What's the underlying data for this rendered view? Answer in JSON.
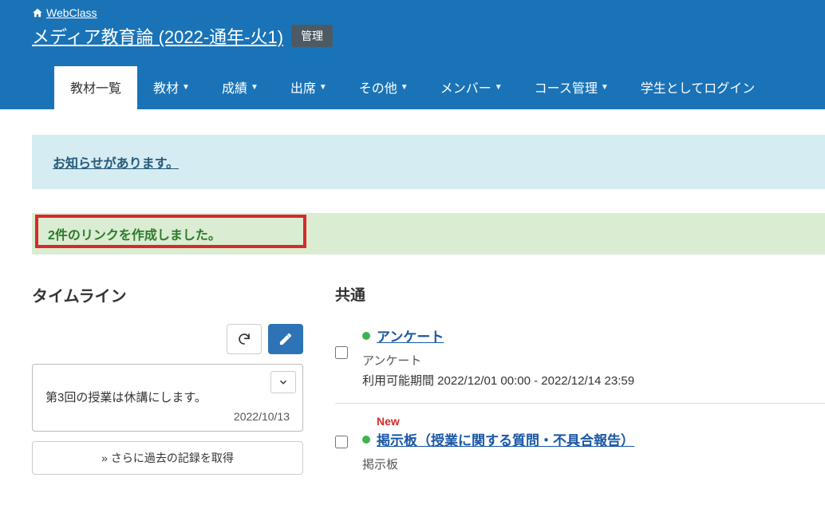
{
  "brand": "WebClass",
  "course": {
    "title": "メディア教育論 (2022-通年-火1)",
    "admin_label": "管理"
  },
  "nav": {
    "active": "教材一覧",
    "items": [
      {
        "label": "教材一覧",
        "dropdown": false
      },
      {
        "label": "教材",
        "dropdown": true
      },
      {
        "label": "成績",
        "dropdown": true
      },
      {
        "label": "出席",
        "dropdown": true
      },
      {
        "label": "その他",
        "dropdown": true
      },
      {
        "label": "メンバー",
        "dropdown": true
      },
      {
        "label": "コース管理",
        "dropdown": true
      },
      {
        "label": "学生としてログイン",
        "dropdown": false
      }
    ]
  },
  "notice": {
    "text": "お知らせがあります。"
  },
  "success": {
    "text": "2件のリンクを作成しました。"
  },
  "timeline": {
    "heading": "タイムライン",
    "item": {
      "message": "第3回の授業は休講にします。",
      "date": "2022/10/13"
    },
    "more": "» さらに過去の記録を取得"
  },
  "materials": {
    "heading": "共通",
    "items": [
      {
        "title": "アンケート",
        "type": "アンケート",
        "period": "利用可能期間 2022/12/01 00:00 - 2022/12/14 23:59",
        "new": false
      },
      {
        "title": "掲示板（授業に関する質問・不具合報告）",
        "type": "掲示板",
        "period": "",
        "new": true,
        "new_label": "New"
      }
    ]
  }
}
